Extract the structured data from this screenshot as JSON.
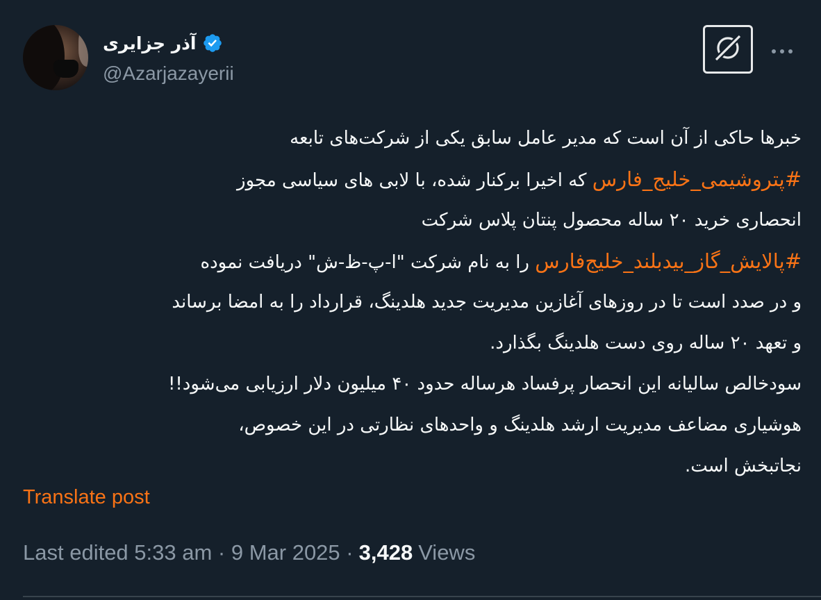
{
  "author": {
    "display_name": "آذر جزایری",
    "handle": "@Azarjazayerii",
    "verified": true,
    "verified_color": "#1d9bf0",
    "avatar_icon": "profile-photo"
  },
  "actions": {
    "grok_icon": "grok-icon",
    "more_icon": "more-horizontal-icon",
    "more_glyph": "···"
  },
  "tweet": {
    "lines": [
      {
        "pre": "خبرها حاکی از آن است که مدیر عامل سابق یکی از شرکت‌های تابعه",
        "tag": "",
        "post": ""
      },
      {
        "pre": "",
        "tag": "#پتروشیمی_خلیج_فارس",
        "post": " که اخیرا برکنار شده، با لابی های سیاسی مجوز"
      },
      {
        "pre": "انحصاری خرید ۲۰ ساله محصول پنتان پلاس شرکت",
        "tag": "",
        "post": ""
      },
      {
        "pre": "",
        "tag": "#پالایش_گاز_بیدبلند_خلیج‌فارس",
        "post": " را به نام شرکت \"ا-پ-ظ-ش\" دریافت نموده"
      },
      {
        "pre": "و در صدد است تا در روزهای آغازین مدیریت جدید هلدینگ، قرارداد را به امضا برساند",
        "tag": "",
        "post": ""
      },
      {
        "pre": "و تعهد ۲۰ ساله روی دست هلدینگ بگذارد.",
        "tag": "",
        "post": ""
      },
      {
        "pre": "سودخالص سالیانه این انحصار پرفساد هرساله حدود ۴۰ میلیون دلار ارزیابی می‌شود!!",
        "tag": "",
        "post": ""
      },
      {
        "pre": "هوشیاری مضاعف مدیریت ارشد هلدینگ و واحدهای نظارتی در این خصوص،",
        "tag": "",
        "post": ""
      },
      {
        "pre": "نجاتبخش است.",
        "tag": "",
        "post": ""
      }
    ],
    "hashtag_color": "#f97316"
  },
  "translate_label": "Translate post",
  "meta": {
    "edited_label": "Last edited 5:33 am · 9 Mar 2025 ·",
    "views_count": "3,428",
    "views_label": "Views"
  }
}
